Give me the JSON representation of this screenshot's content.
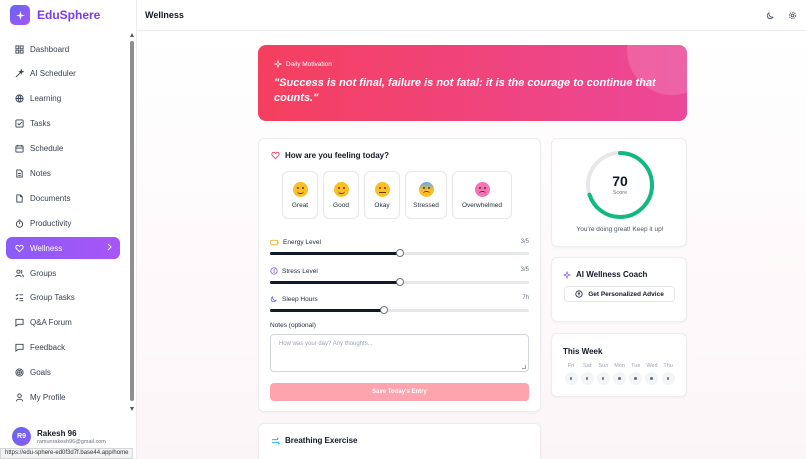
{
  "app": {
    "name": "EduSphere"
  },
  "sidebar": {
    "items": [
      {
        "label": "Dashboard",
        "icon": "dashboard-icon"
      },
      {
        "label": "AI Scheduler",
        "icon": "wand-icon"
      },
      {
        "label": "Learning",
        "icon": "globe-icon"
      },
      {
        "label": "Tasks",
        "icon": "checkbox-icon"
      },
      {
        "label": "Schedule",
        "icon": "calendar-icon"
      },
      {
        "label": "Notes",
        "icon": "note-icon"
      },
      {
        "label": "Documents",
        "icon": "document-icon"
      },
      {
        "label": "Productivity",
        "icon": "timer-icon"
      },
      {
        "label": "Wellness",
        "icon": "heart-icon",
        "active": true
      },
      {
        "label": "Groups",
        "icon": "users-icon"
      },
      {
        "label": "Group Tasks",
        "icon": "list-check-icon"
      },
      {
        "label": "Q&A Forum",
        "icon": "chat-icon"
      },
      {
        "label": "Feedback",
        "icon": "message-icon"
      },
      {
        "label": "Goals",
        "icon": "target-icon"
      },
      {
        "label": "My Profile",
        "icon": "user-icon"
      }
    ]
  },
  "user": {
    "initials": "R9",
    "name": "Rakesh 96",
    "email": "ramunrakesh96@gmail.com"
  },
  "status_url": "https://edu-sphere-ed0f3d7f.base44.app/home",
  "header": {
    "title": "Wellness"
  },
  "motivation": {
    "label": "Daily Motivation",
    "quote": "\"Success is not final, failure is not fatal: it is the courage to continue that counts.\""
  },
  "mood": {
    "title": "How are you feeling today?",
    "options": [
      {
        "label": "Great",
        "width": 36
      },
      {
        "label": "Good",
        "width": 36
      },
      {
        "label": "Okay",
        "width": 36
      },
      {
        "label": "Stressed",
        "width": 42
      },
      {
        "label": "Overwhelmed",
        "width": 60
      }
    ],
    "sliders": [
      {
        "label": "Energy Level",
        "value": "3/5",
        "fraction": 0.5
      },
      {
        "label": "Stress Level",
        "value": "3/5",
        "fraction": 0.5
      },
      {
        "label": "Sleep Hours",
        "value": "7h",
        "fraction": 0.44
      }
    ],
    "notes_label": "Notes (optional)",
    "notes_placeholder": "How was your day? Any thoughts...",
    "save_label": "Save Today's Entry"
  },
  "score": {
    "value": "70",
    "label": "Score",
    "fraction": 0.7,
    "message": "You're doing great! Keep it up!",
    "color": "#10b981"
  },
  "coach": {
    "title": "AI Wellness Coach",
    "button": "Get Personalized Advice"
  },
  "week": {
    "title": "This Week",
    "days": [
      "Fri",
      "Sat",
      "Sun",
      "Mon",
      "Tue",
      "Wed",
      "Thu"
    ]
  },
  "breathing": {
    "title": "Breathing Exercise"
  },
  "colors": {
    "accent": "#8b5cf6",
    "motivation": "#f43f5e",
    "save": "#fda4af"
  }
}
